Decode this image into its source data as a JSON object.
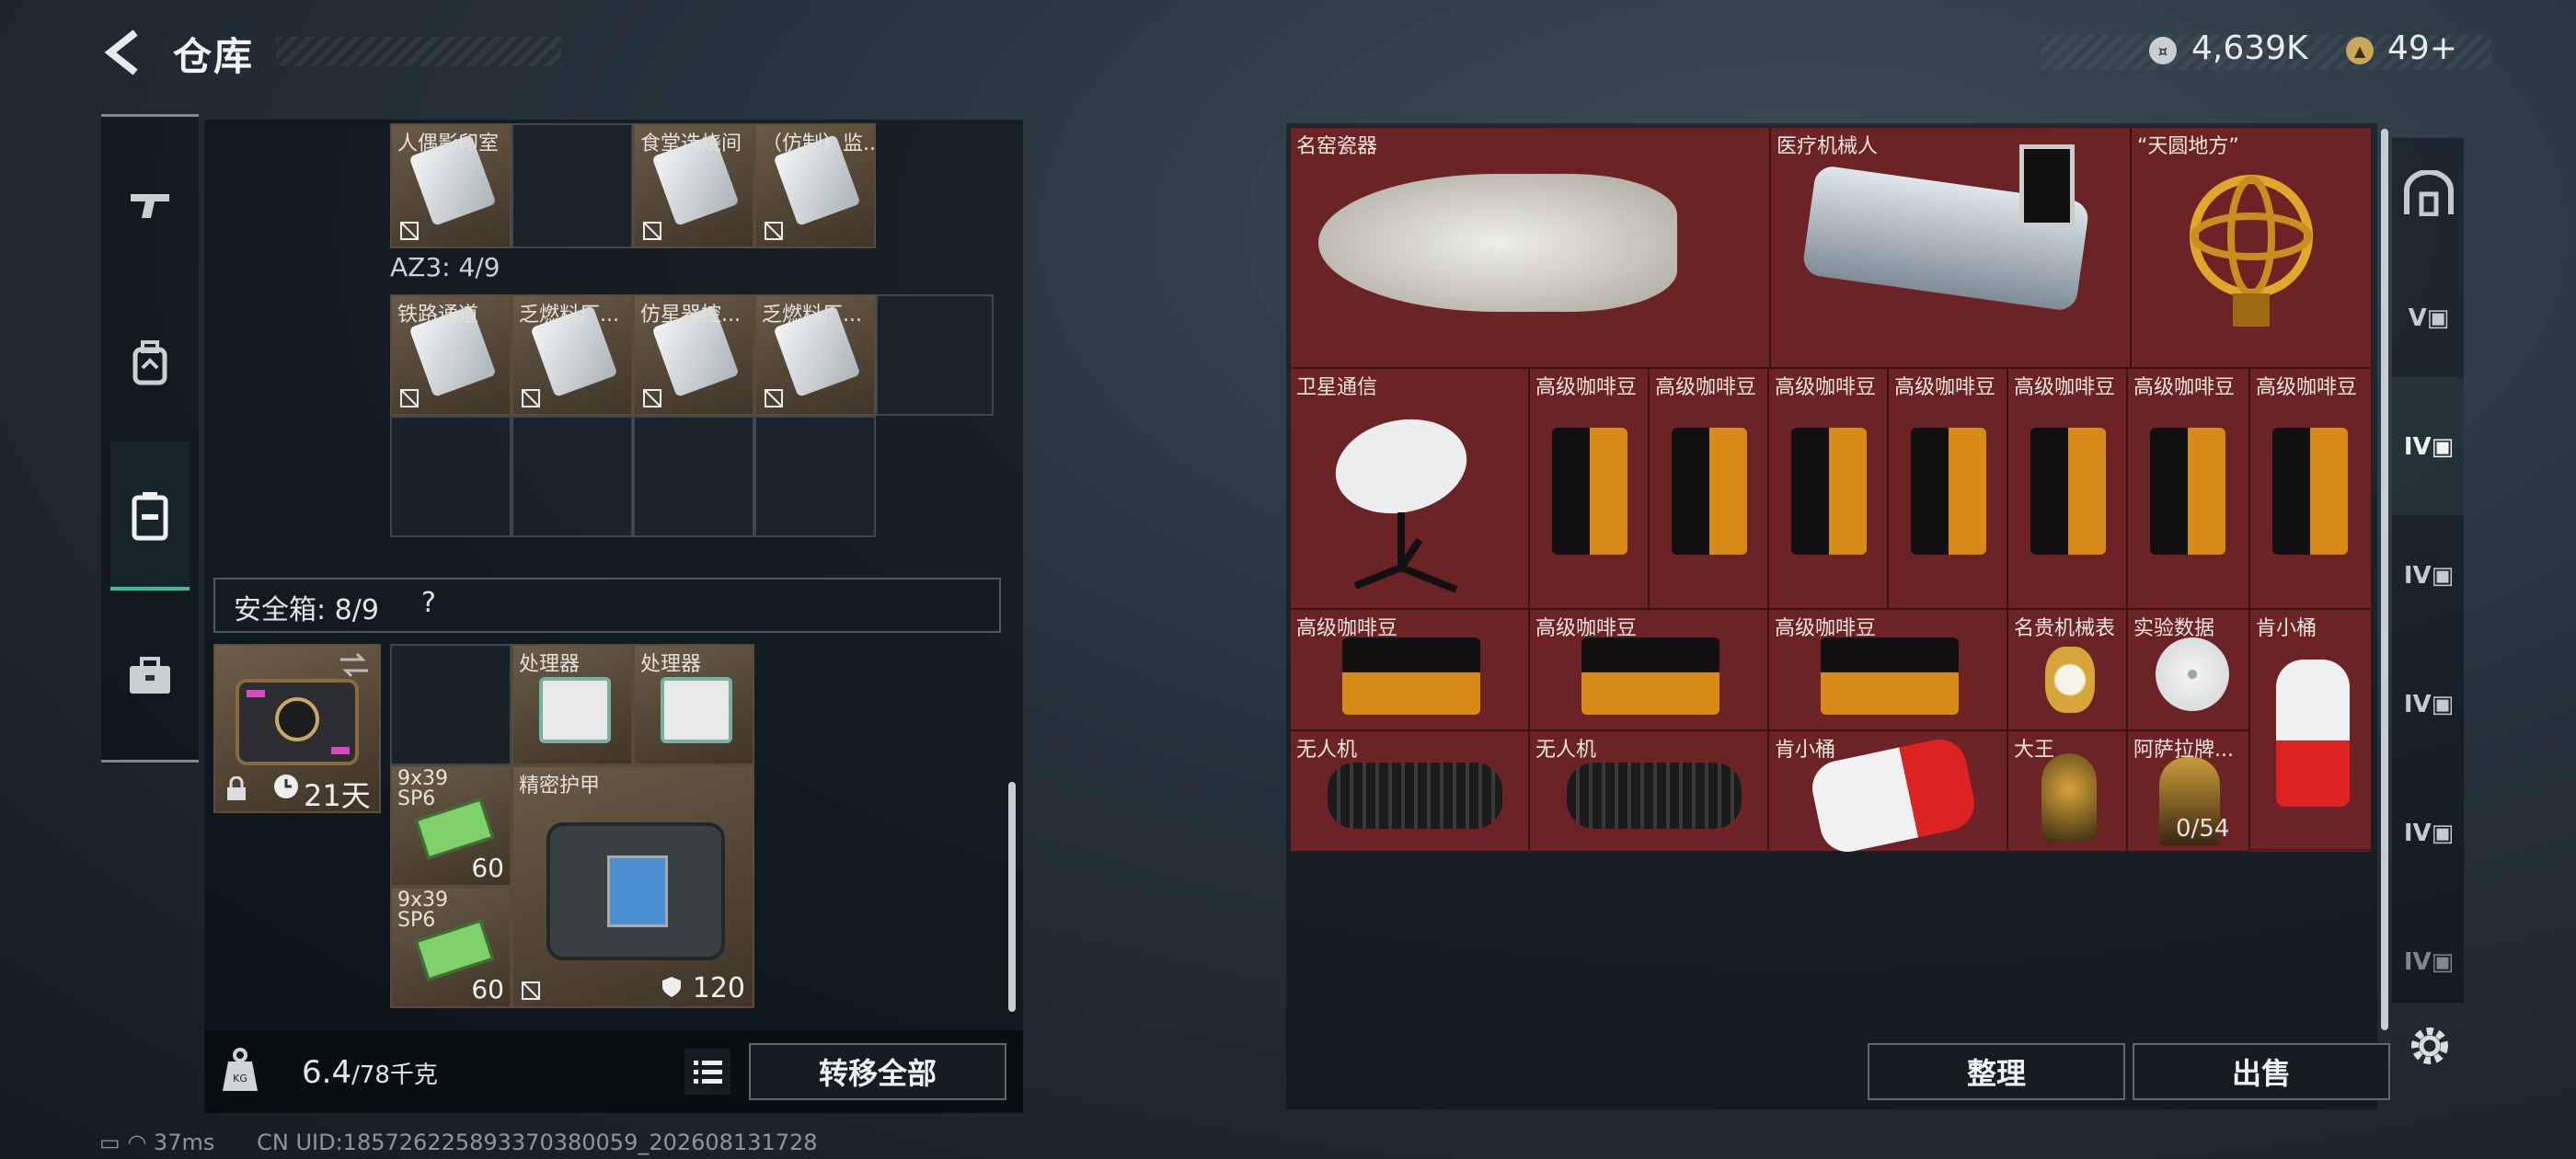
{
  "header": {
    "title": "仓库",
    "money": "4,639K",
    "tickets": "49+",
    "money_icon": "coin-icon",
    "ticket_icon": "triangle-coin-icon"
  },
  "left_sidebar": {
    "items": [
      "gun-icon",
      "backpack-icon",
      "case-icon",
      "toolbox-icon"
    ],
    "active": 2
  },
  "containers": {
    "top_items": [
      "人偶影印室",
      "食堂选烧间",
      "（仿制）监..."
    ],
    "az3_label": "AZ3: 4/9",
    "az3_items": [
      "铁路通道",
      "乏燃料厂...",
      "仿星器控...",
      "乏燃料厂..."
    ],
    "safe_label": "安全箱: 8/9",
    "safe_help": "?",
    "safe_days": "21天",
    "safe_items": {
      "processor_1": "处理器",
      "processor_2": "处理器",
      "ammo_1": "9x39 SP6",
      "ammo_1_count": "60",
      "ammo_2": "9x39 SP6",
      "ammo_2_count": "60",
      "armor": "精密护甲",
      "armor_durability": "120"
    }
  },
  "weight": {
    "value": "6.4",
    "unit": "/78千克"
  },
  "buttons": {
    "transfer_all": "转移全部",
    "sort": "整理",
    "sell": "出售"
  },
  "market": {
    "row1": [
      "名窑瓷器",
      "医疗机械人",
      "“天圆地方”"
    ],
    "row2": [
      "卫星通信",
      "高级咖啡豆",
      "高级咖啡豆",
      "高级咖啡豆",
      "高级咖啡豆",
      "高级咖啡豆",
      "高级咖啡豆",
      "高级咖啡豆"
    ],
    "row3": [
      "高级咖啡豆",
      "高级咖啡豆",
      "高级咖啡豆",
      "名贵机械表",
      "实验数据",
      "肯小桶"
    ],
    "row4": [
      "无人机",
      "无人机",
      "肯小桶",
      "大王",
      "阿萨拉牌..."
    ],
    "count": "0/54"
  },
  "right_sidebar": {
    "items": [
      "base-icon",
      "tier-v",
      "tier-iv",
      "tier-iv",
      "tier-iv",
      "tier-iv",
      "tier-iv"
    ],
    "active": 2
  },
  "status": {
    "ping": "37ms",
    "uid": "CN UID:18572622589337038005​9_202608131728"
  },
  "colors": {
    "accent": "#3fbf94",
    "market_bg": "#6b2326",
    "item_bg": "#5a4b39"
  }
}
